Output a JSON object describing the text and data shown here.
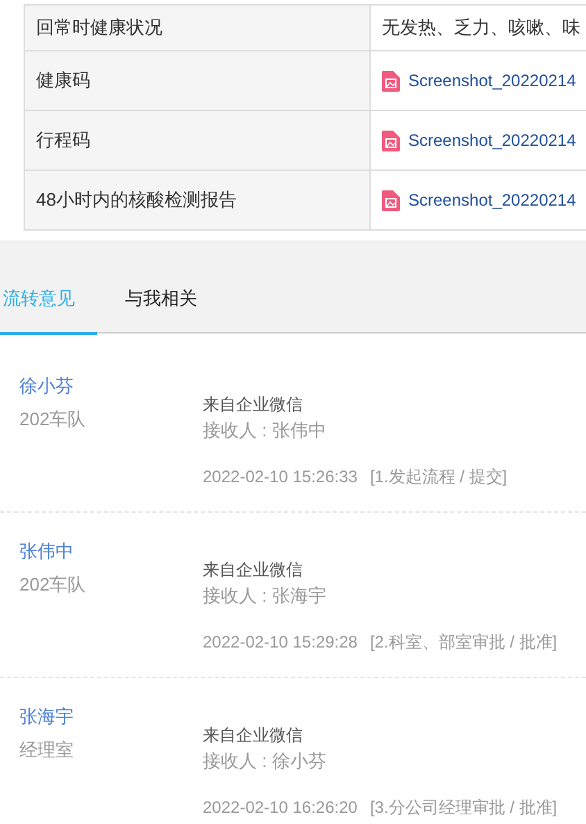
{
  "table": {
    "rows": [
      {
        "label": "回常时健康状况",
        "kind": "text",
        "value": "无发热、乏力、咳嗽、味"
      },
      {
        "label": "健康码",
        "kind": "file",
        "value": "Screenshot_20220214"
      },
      {
        "label": "行程码",
        "kind": "file",
        "value": "Screenshot_20220214"
      },
      {
        "label": "48小时内的核酸检测报告",
        "kind": "file",
        "value": "Screenshot_20220214"
      }
    ]
  },
  "tabs": [
    {
      "label": "流转意见",
      "selected": true
    },
    {
      "label": "与我相关",
      "selected": false
    }
  ],
  "opinions": [
    {
      "name": "徐小芬",
      "dept": "202车队",
      "source": "来自企业微信",
      "receiver": "接收人 : 张伟中",
      "time": "2022-02-10 15:26:33",
      "step": "[1.发起流程 / 提交]"
    },
    {
      "name": "张伟中",
      "dept": "202车队",
      "source": "来自企业微信",
      "receiver": "接收人 : 张海宇",
      "time": "2022-02-10 15:29:28",
      "step": "[2.科室、部室审批 / 批准]"
    },
    {
      "name": "张海宇",
      "dept": "经理室",
      "source": "来自企业微信",
      "receiver": "接收人 : 徐小芬",
      "time": "2022-02-10 16:26:20",
      "step": "[3.分公司经理审批 / 批准]"
    }
  ]
}
